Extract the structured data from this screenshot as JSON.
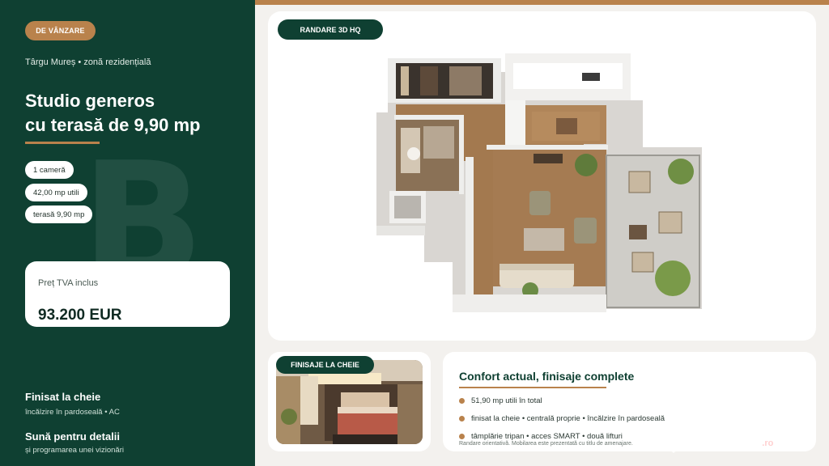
{
  "sidebar": {
    "badge": "DE VÂNZARE",
    "location": "Târgu Mureș • zonă rezidențială",
    "title_line1": "Studio generos",
    "title_line2": "cu terasă de 9,90 mp",
    "chips": [
      "1 cameră",
      "42,00 mp utili",
      "terasă 9,90 mp"
    ],
    "price_label": "Preț TVA inclus",
    "price_value": "93.200 EUR",
    "finish_title": "Finisat la cheie",
    "finish_sub": "încălzire în pardoseală • AC",
    "call_title": "Sună pentru detalii",
    "call_sub": "și programarea unei vizionări",
    "watermark_letter": "B"
  },
  "render": {
    "badge": "RANDARE 3D HQ"
  },
  "photo": {
    "badge": "FINISAJE LA CHEIE"
  },
  "info": {
    "title": "Confort actual, finisaje complete",
    "bullets": [
      "51,90 mp utili în total",
      "finisat la cheie • centrală proprie • încălzire în pardoseală",
      "tâmplărie tripan • acces SMART • două lifturi"
    ],
    "disclaimer": "Randare orientativă. Mobilarea este prezentată cu titlu de amenajare."
  },
  "watermark": {
    "brand": "lajumate",
    "tld": ".ro"
  },
  "colors": {
    "green": "#0f4032",
    "accent": "#b9824c",
    "background": "#f3f1ee"
  }
}
